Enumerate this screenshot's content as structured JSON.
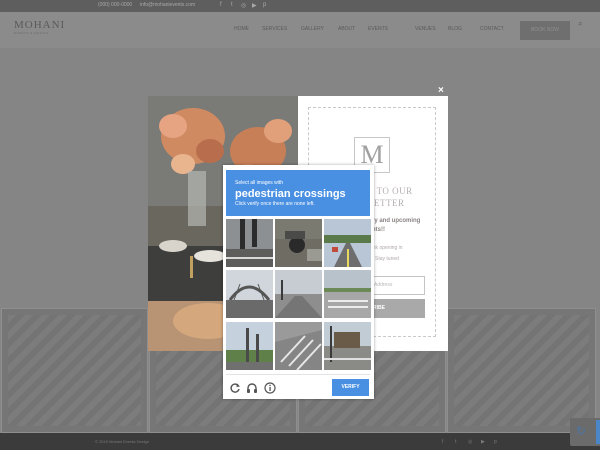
{
  "site": {
    "topbar": {
      "phone": "(000) 000-0000",
      "email": "info@mohanievents.com"
    },
    "logo": "MOHANI",
    "logo_sub": "EVENTS & DESIGN",
    "nav": [
      "HOME",
      "SERVICES",
      "GALLERY",
      "ABOUT",
      "EVENTS",
      "VENUES",
      "BLOG",
      "CONTACT"
    ],
    "book_button": "BOOK NOW",
    "footer_text": "© 2019 Mohani Events Design"
  },
  "newsletter": {
    "close_label": "×",
    "logo_letter": "M",
    "heading_line1": "E TO OUR",
    "heading_line2": "LETTER",
    "sub_line1": "ry and upcoming",
    "sub_line2": "nts!!",
    "small_line1": "unk opening in",
    "small_line2": "Stay tuned",
    "email_placeholder": "Address",
    "subscribe_label": "RIBE"
  },
  "captcha": {
    "instruction_small": "Select all images with",
    "target": "pedestrian crossings",
    "note": "Click verify once there are none left.",
    "verify_label": "VERIFY",
    "controls": [
      "reload-icon",
      "headphones-icon",
      "info-icon"
    ],
    "colors": {
      "accent": "#4a90e2"
    }
  }
}
